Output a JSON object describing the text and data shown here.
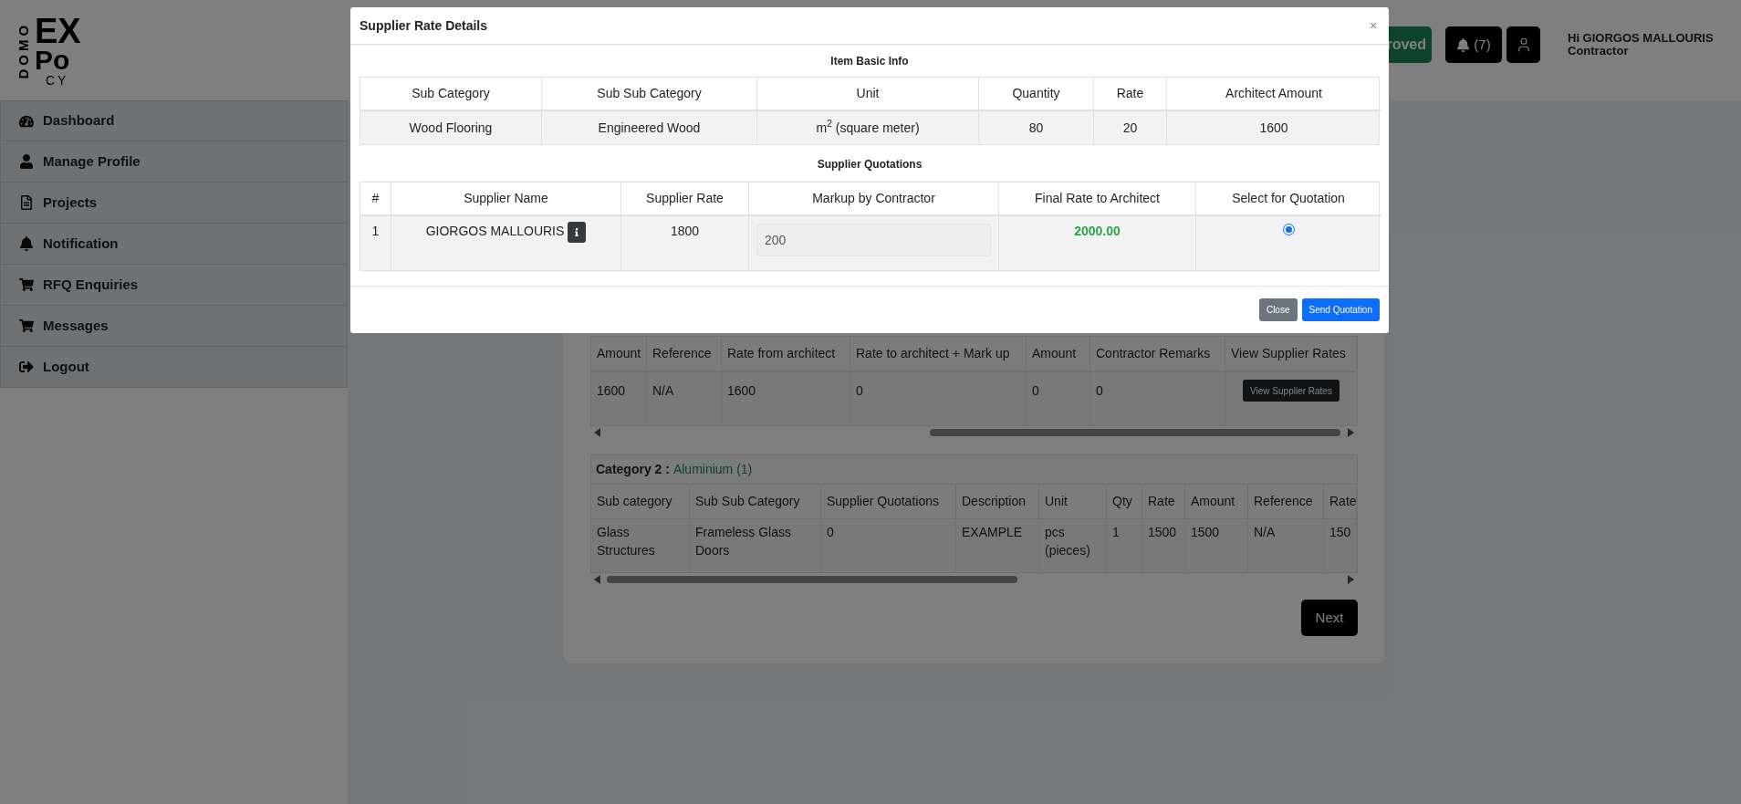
{
  "logo": {
    "vertical": "DOMO",
    "top": "EX",
    "bottom": "Po",
    "small": "CY"
  },
  "header": {
    "status_button": "roved",
    "notifications": "(7)",
    "greeting": "Hi GIORGOS MALLOURIS",
    "role": "Contractor"
  },
  "sidebar": {
    "items": [
      {
        "label": "Dashboard",
        "kind": "dashboard"
      },
      {
        "label": "Manage Profile",
        "kind": "profile"
      },
      {
        "label": "Projects",
        "kind": "projects"
      },
      {
        "label": "Notification",
        "kind": "notification"
      },
      {
        "label": "RFQ Enquiries",
        "kind": "enquiries"
      },
      {
        "label": "Messages",
        "kind": "messages"
      },
      {
        "label": "Logout",
        "kind": "logout"
      }
    ]
  },
  "category_1_table": {
    "columns": [
      "Amount",
      "Reference",
      "Rate from architect",
      "Rate to architect + Mark up",
      "Amount",
      "Contractor Remarks",
      "View Supplier Rates"
    ],
    "rows": [
      [
        "1600",
        "N/A",
        "1600",
        "0",
        "0",
        "0",
        {
          "button": "View Supplier Rates"
        }
      ]
    ]
  },
  "category_2": {
    "label": "Category 2 :",
    "value": "Aluminium (1)",
    "columns": [
      "Sub category",
      "Sub Sub Category",
      "Supplier Quotations",
      "Description",
      "Unit",
      "Qty",
      "Rate",
      "Amount",
      "Reference",
      "Rate"
    ],
    "rows": [
      [
        "Glass Structures",
        "Frameless Glass Doors",
        "0",
        "EXAMPLE",
        "pcs (pieces)",
        "1",
        "1500",
        "1500",
        "N/A",
        "150"
      ]
    ]
  },
  "next_button": "Next",
  "modal": {
    "title": "Supplier Rate Details",
    "close_icon": "×",
    "basic_info": {
      "heading": "Item Basic Info",
      "columns": [
        "Sub Category",
        "Sub Sub Category",
        "Unit",
        "Quantity",
        "Rate",
        "Architect Amount"
      ],
      "rows": [
        [
          "Wood Flooring",
          "Engineered Wood",
          "m$^{2}$ (square meter)",
          "80",
          "20",
          "1600"
        ]
      ]
    },
    "supplier_quotations": {
      "heading": "Supplier Quotations",
      "columns": [
        "#",
        "Supplier Name",
        "Supplier Rate",
        "Markup by Contractor",
        "Final Rate to Architect",
        "Select for Quotation"
      ],
      "rows": [
        {
          "index": "1",
          "supplier": "GIORGOS MALLOURIS",
          "rate": "1800",
          "markup": "200",
          "final_rate": "2000.00",
          "selected": true
        }
      ]
    },
    "buttons": [
      {
        "label": "Close",
        "kind": "secondary"
      },
      {
        "label": "Send Quotation",
        "kind": "primary"
      }
    ]
  }
}
